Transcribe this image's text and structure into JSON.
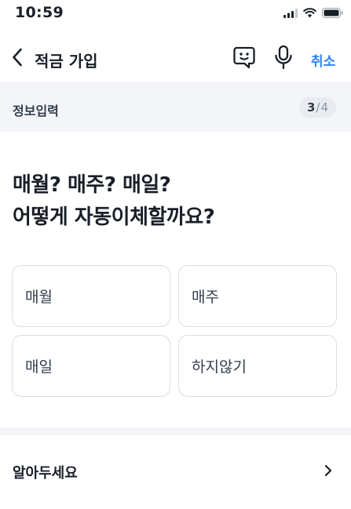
{
  "status_bar": {
    "time": "10:59",
    "icons": [
      "cellular-signal-icon",
      "wifi-icon",
      "battery-icon"
    ]
  },
  "nav": {
    "title": "적금 가입",
    "cancel_label": "취소",
    "icons": [
      "chevron-left-icon",
      "chat-face-icon",
      "microphone-icon"
    ]
  },
  "step": {
    "label": "정보입력",
    "current": "3",
    "separator": "/",
    "total": "4"
  },
  "question": {
    "line1": "매월? 매주? 매일?",
    "line2": "어떻게 자동이체할까요?"
  },
  "options": [
    "매월",
    "매주",
    "매일",
    "하지않기"
  ],
  "notice": {
    "label": "알아두세요"
  },
  "colors": {
    "accent": "#3182f6",
    "text": "#191f28",
    "section_background": "#f3f5f8",
    "option_border": "#d8dce2"
  }
}
